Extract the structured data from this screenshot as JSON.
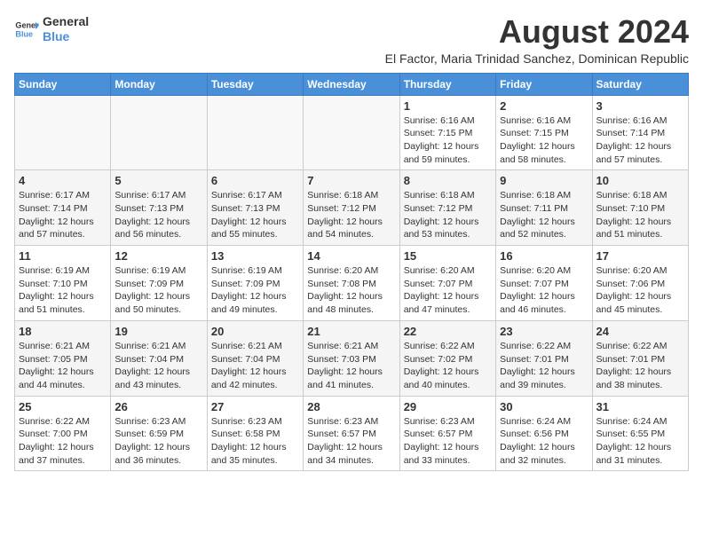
{
  "header": {
    "logo_line1": "General",
    "logo_line2": "Blue",
    "main_title": "August 2024",
    "subtitle": "El Factor, Maria Trinidad Sanchez, Dominican Republic"
  },
  "calendar": {
    "days_of_week": [
      "Sunday",
      "Monday",
      "Tuesday",
      "Wednesday",
      "Thursday",
      "Friday",
      "Saturday"
    ],
    "weeks": [
      [
        {
          "day": "",
          "info": ""
        },
        {
          "day": "",
          "info": ""
        },
        {
          "day": "",
          "info": ""
        },
        {
          "day": "",
          "info": ""
        },
        {
          "day": "1",
          "info": "Sunrise: 6:16 AM\nSunset: 7:15 PM\nDaylight: 12 hours and 59 minutes."
        },
        {
          "day": "2",
          "info": "Sunrise: 6:16 AM\nSunset: 7:15 PM\nDaylight: 12 hours and 58 minutes."
        },
        {
          "day": "3",
          "info": "Sunrise: 6:16 AM\nSunset: 7:14 PM\nDaylight: 12 hours and 57 minutes."
        }
      ],
      [
        {
          "day": "4",
          "info": "Sunrise: 6:17 AM\nSunset: 7:14 PM\nDaylight: 12 hours and 57 minutes."
        },
        {
          "day": "5",
          "info": "Sunrise: 6:17 AM\nSunset: 7:13 PM\nDaylight: 12 hours and 56 minutes."
        },
        {
          "day": "6",
          "info": "Sunrise: 6:17 AM\nSunset: 7:13 PM\nDaylight: 12 hours and 55 minutes."
        },
        {
          "day": "7",
          "info": "Sunrise: 6:18 AM\nSunset: 7:12 PM\nDaylight: 12 hours and 54 minutes."
        },
        {
          "day": "8",
          "info": "Sunrise: 6:18 AM\nSunset: 7:12 PM\nDaylight: 12 hours and 53 minutes."
        },
        {
          "day": "9",
          "info": "Sunrise: 6:18 AM\nSunset: 7:11 PM\nDaylight: 12 hours and 52 minutes."
        },
        {
          "day": "10",
          "info": "Sunrise: 6:18 AM\nSunset: 7:10 PM\nDaylight: 12 hours and 51 minutes."
        }
      ],
      [
        {
          "day": "11",
          "info": "Sunrise: 6:19 AM\nSunset: 7:10 PM\nDaylight: 12 hours and 51 minutes."
        },
        {
          "day": "12",
          "info": "Sunrise: 6:19 AM\nSunset: 7:09 PM\nDaylight: 12 hours and 50 minutes."
        },
        {
          "day": "13",
          "info": "Sunrise: 6:19 AM\nSunset: 7:09 PM\nDaylight: 12 hours and 49 minutes."
        },
        {
          "day": "14",
          "info": "Sunrise: 6:20 AM\nSunset: 7:08 PM\nDaylight: 12 hours and 48 minutes."
        },
        {
          "day": "15",
          "info": "Sunrise: 6:20 AM\nSunset: 7:07 PM\nDaylight: 12 hours and 47 minutes."
        },
        {
          "day": "16",
          "info": "Sunrise: 6:20 AM\nSunset: 7:07 PM\nDaylight: 12 hours and 46 minutes."
        },
        {
          "day": "17",
          "info": "Sunrise: 6:20 AM\nSunset: 7:06 PM\nDaylight: 12 hours and 45 minutes."
        }
      ],
      [
        {
          "day": "18",
          "info": "Sunrise: 6:21 AM\nSunset: 7:05 PM\nDaylight: 12 hours and 44 minutes."
        },
        {
          "day": "19",
          "info": "Sunrise: 6:21 AM\nSunset: 7:04 PM\nDaylight: 12 hours and 43 minutes."
        },
        {
          "day": "20",
          "info": "Sunrise: 6:21 AM\nSunset: 7:04 PM\nDaylight: 12 hours and 42 minutes."
        },
        {
          "day": "21",
          "info": "Sunrise: 6:21 AM\nSunset: 7:03 PM\nDaylight: 12 hours and 41 minutes."
        },
        {
          "day": "22",
          "info": "Sunrise: 6:22 AM\nSunset: 7:02 PM\nDaylight: 12 hours and 40 minutes."
        },
        {
          "day": "23",
          "info": "Sunrise: 6:22 AM\nSunset: 7:01 PM\nDaylight: 12 hours and 39 minutes."
        },
        {
          "day": "24",
          "info": "Sunrise: 6:22 AM\nSunset: 7:01 PM\nDaylight: 12 hours and 38 minutes."
        }
      ],
      [
        {
          "day": "25",
          "info": "Sunrise: 6:22 AM\nSunset: 7:00 PM\nDaylight: 12 hours and 37 minutes."
        },
        {
          "day": "26",
          "info": "Sunrise: 6:23 AM\nSunset: 6:59 PM\nDaylight: 12 hours and 36 minutes."
        },
        {
          "day": "27",
          "info": "Sunrise: 6:23 AM\nSunset: 6:58 PM\nDaylight: 12 hours and 35 minutes."
        },
        {
          "day": "28",
          "info": "Sunrise: 6:23 AM\nSunset: 6:57 PM\nDaylight: 12 hours and 34 minutes."
        },
        {
          "day": "29",
          "info": "Sunrise: 6:23 AM\nSunset: 6:57 PM\nDaylight: 12 hours and 33 minutes."
        },
        {
          "day": "30",
          "info": "Sunrise: 6:24 AM\nSunset: 6:56 PM\nDaylight: 12 hours and 32 minutes."
        },
        {
          "day": "31",
          "info": "Sunrise: 6:24 AM\nSunset: 6:55 PM\nDaylight: 12 hours and 31 minutes."
        }
      ]
    ]
  }
}
